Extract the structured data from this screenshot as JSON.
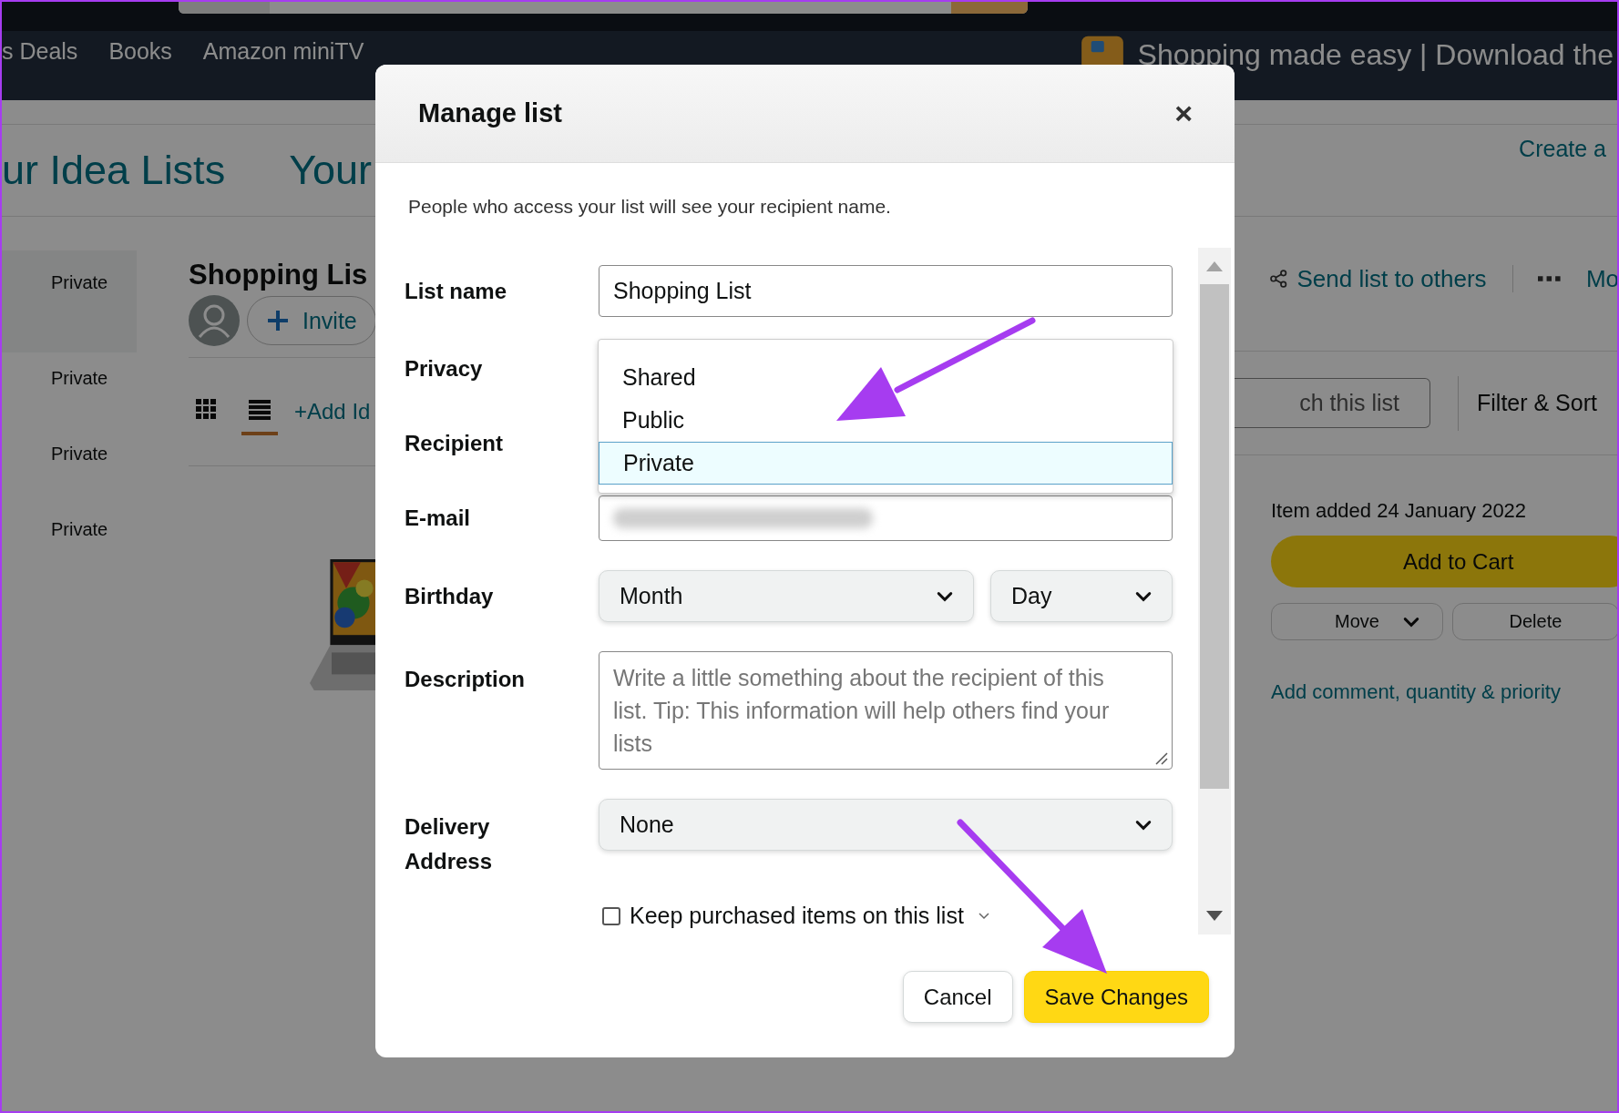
{
  "nav": {
    "items": [
      {
        "label": "s Deals"
      },
      {
        "label": "Books"
      },
      {
        "label": "Amazon miniTV"
      }
    ],
    "banner": "Shopping made easy | Download the"
  },
  "page": {
    "tabs": [
      "ur Idea Lists",
      "Your"
    ],
    "create_link": "Create a",
    "sidebar": [
      {
        "label": "Private",
        "selected": true
      },
      {
        "label": "Private",
        "selected": false
      },
      {
        "label": "Private",
        "selected": false
      },
      {
        "label": "Private",
        "selected": false
      }
    ],
    "list_title": "Shopping Lis",
    "invite": "Invite",
    "send_link": "Send list to others",
    "more_link": "Mo",
    "view_modes": [
      {
        "kind": "grid",
        "selected": false
      },
      {
        "kind": "list",
        "selected": true
      }
    ],
    "add_idea": "+Add Id",
    "search_placeholder": "ch this list",
    "filter": "Filter & Sort",
    "item": {
      "added": "Item added 24 January 2022",
      "add_to_cart": "Add to Cart",
      "move": "Move",
      "delete": "Delete",
      "comment": "Add comment, quantity & priority"
    }
  },
  "dialog": {
    "title": "Manage list",
    "close": "×",
    "notice": "People who access your list will see your recipient name.",
    "fields": [
      {
        "kind": "text",
        "label": "List name",
        "value": "Shopping List"
      },
      {
        "kind": "dropdown",
        "label": "Privacy",
        "options": [
          {
            "label": "Shared",
            "selected": false
          },
          {
            "label": "Public",
            "selected": false
          },
          {
            "label": "Private",
            "selected": true
          }
        ]
      },
      {
        "kind": "hidden",
        "label": "Recipient"
      },
      {
        "kind": "redacted",
        "label": "E-mail"
      },
      {
        "kind": "selects",
        "label": "Birthday",
        "selects": [
          "Month",
          "Day"
        ]
      },
      {
        "kind": "textarea",
        "label": "Description",
        "placeholder": "Write a little something about the recipient of this list. Tip: This information will help others find your lists"
      },
      {
        "kind": "select",
        "label": "Delivery Address",
        "value": "None"
      },
      {
        "kind": "checkbox",
        "label": "Keep purchased items on this list",
        "checked": false
      }
    ],
    "buttons": [
      {
        "label": "Cancel",
        "primary": false
      },
      {
        "label": "Save Changes",
        "primary": true
      }
    ]
  }
}
